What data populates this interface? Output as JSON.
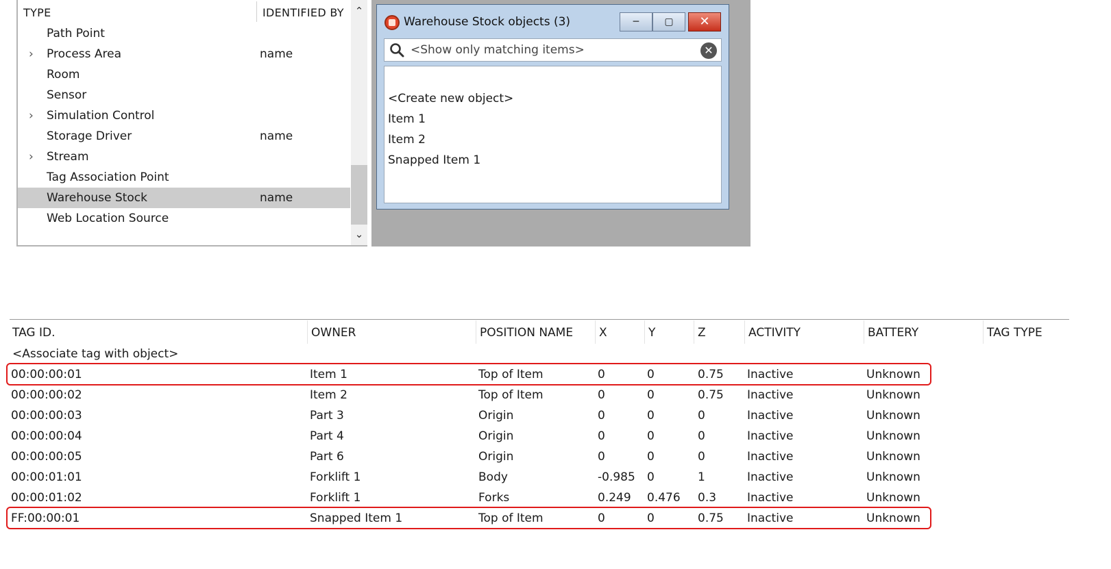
{
  "type_list": {
    "headers": {
      "type": "TYPE",
      "identified_by": "IDENTIFIED BY"
    },
    "rows": [
      {
        "name": "Path Point",
        "identified_by": "",
        "expandable": false,
        "selected": false
      },
      {
        "name": "Process Area",
        "identified_by": "name",
        "expandable": true,
        "selected": false
      },
      {
        "name": "Room",
        "identified_by": "",
        "expandable": false,
        "selected": false
      },
      {
        "name": "Sensor",
        "identified_by": "",
        "expandable": false,
        "selected": false
      },
      {
        "name": "Simulation Control",
        "identified_by": "",
        "expandable": true,
        "selected": false
      },
      {
        "name": "Storage Driver",
        "identified_by": "name",
        "expandable": false,
        "selected": false
      },
      {
        "name": "Stream",
        "identified_by": "",
        "expandable": true,
        "selected": false
      },
      {
        "name": "Tag Association Point",
        "identified_by": "",
        "expandable": false,
        "selected": false
      },
      {
        "name": "Warehouse Stock",
        "identified_by": "name",
        "expandable": false,
        "selected": true
      },
      {
        "name": "Web Location Source",
        "identified_by": "",
        "expandable": false,
        "selected": false
      }
    ],
    "icons": {
      "expand": "chevron-right-icon",
      "scroll_up": "chevron-up-icon",
      "scroll_down": "chevron-down-icon"
    },
    "selected_color": "#cccccc"
  },
  "dialog": {
    "title": "Warehouse Stock objects (3)",
    "icons": {
      "app": "app-logo-icon",
      "minimize": "minimize-icon",
      "maximize": "maximize-icon",
      "close": "close-icon",
      "search": "search-icon",
      "clear": "clear-circle-icon"
    },
    "search": {
      "placeholder": "<Show only matching items>",
      "value": ""
    },
    "items": [
      "<Create new object>",
      "Item 1",
      "Item 2",
      "Snapped Item 1"
    ]
  },
  "tag_table": {
    "columns": [
      "TAG ID.",
      "OWNER",
      "POSITION NAME",
      "X",
      "Y",
      "Z",
      "ACTIVITY",
      "BATTERY",
      "TAG TYPE"
    ],
    "associate_row": "<Associate tag with object>",
    "rows": [
      {
        "tag_id": "00:00:00:01",
        "owner": "Item 1",
        "position": "Top of Item",
        "x": "0",
        "y": "0",
        "z": "0.75",
        "activity": "Inactive",
        "battery": "Unknown",
        "tag_type": "",
        "highlighted": true
      },
      {
        "tag_id": "00:00:00:02",
        "owner": "Item 2",
        "position": "Top of Item",
        "x": "0",
        "y": "0",
        "z": "0.75",
        "activity": "Inactive",
        "battery": "Unknown",
        "tag_type": "",
        "highlighted": false
      },
      {
        "tag_id": "00:00:00:03",
        "owner": "Part 3",
        "position": "Origin",
        "x": "0",
        "y": "0",
        "z": "0",
        "activity": "Inactive",
        "battery": "Unknown",
        "tag_type": "",
        "highlighted": false
      },
      {
        "tag_id": "00:00:00:04",
        "owner": "Part 4",
        "position": "Origin",
        "x": "0",
        "y": "0",
        "z": "0",
        "activity": "Inactive",
        "battery": "Unknown",
        "tag_type": "",
        "highlighted": false
      },
      {
        "tag_id": "00:00:00:05",
        "owner": "Part 6",
        "position": "Origin",
        "x": "0",
        "y": "0",
        "z": "0",
        "activity": "Inactive",
        "battery": "Unknown",
        "tag_type": "",
        "highlighted": false
      },
      {
        "tag_id": "00:00:01:01",
        "owner": "Forklift 1",
        "position": "Body",
        "x": "-0.985",
        "y": "0",
        "z": "1",
        "activity": "Inactive",
        "battery": "Unknown",
        "tag_type": "",
        "highlighted": false
      },
      {
        "tag_id": "00:00:01:02",
        "owner": "Forklift 1",
        "position": "Forks",
        "x": "0.249",
        "y": "0.476",
        "z": "0.3",
        "activity": "Inactive",
        "battery": "Unknown",
        "tag_type": "",
        "highlighted": false
      },
      {
        "tag_id": "FF:00:00:01",
        "owner": "Snapped Item 1",
        "position": "Top of Item",
        "x": "0",
        "y": "0",
        "z": "0.75",
        "activity": "Inactive",
        "battery": "Unknown",
        "tag_type": "",
        "highlighted": true
      }
    ],
    "highlight_color": "#e01a1a"
  }
}
